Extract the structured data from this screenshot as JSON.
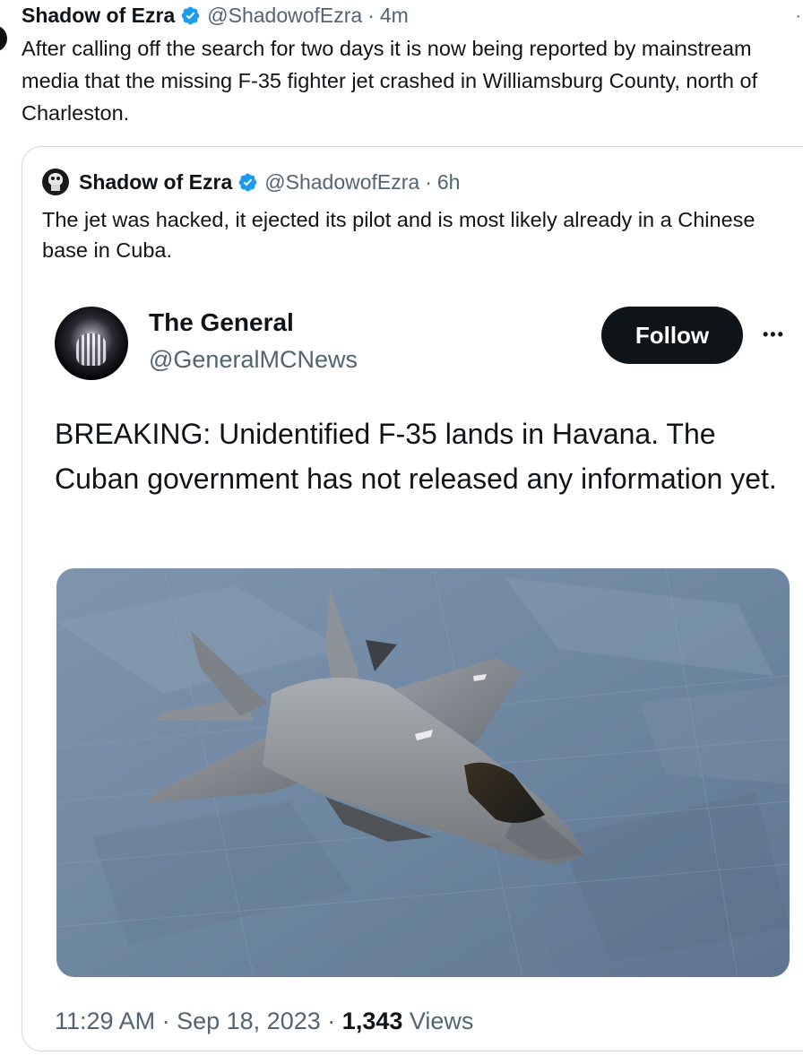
{
  "outer_post": {
    "author_name": "Shadow of Ezra",
    "handle": "@ShadowofEzra",
    "separator": "·",
    "time": "4m",
    "text": "After calling off the search for two days it is now being reported by mainstream media that the missing F-35 fighter jet crashed in Williamsburg County, north of Charleston."
  },
  "quoted_post": {
    "author_name": "Shadow of Ezra",
    "handle": "@ShadowofEzra",
    "separator": "·",
    "time": "6h",
    "text": "The jet was hacked, it ejected its pilot and is most likely already in a Chinese base in Cuba."
  },
  "embedded_post": {
    "author_name": "The General",
    "handle": "@GeneralMCNews",
    "follow_label": "Follow",
    "more_label": "•••",
    "text": "BREAKING: Unidentified F-35 lands in Havana. The Cuban government has not released any information yet.",
    "image_subject": "F-35 fighter jet in flight over countryside",
    "time": "11:29 AM",
    "date": "Sep 18, 2023",
    "separator": "·",
    "views_count": "1,343",
    "views_label": "Views"
  },
  "icons": {
    "verified": "verified-badge-icon",
    "more": "more-options-icon"
  },
  "colors": {
    "text": "#0f1419",
    "secondary": "#536471",
    "verified_blue": "#1d9bf0",
    "border": "#cfd9de",
    "follow_bg": "#0f1419"
  }
}
